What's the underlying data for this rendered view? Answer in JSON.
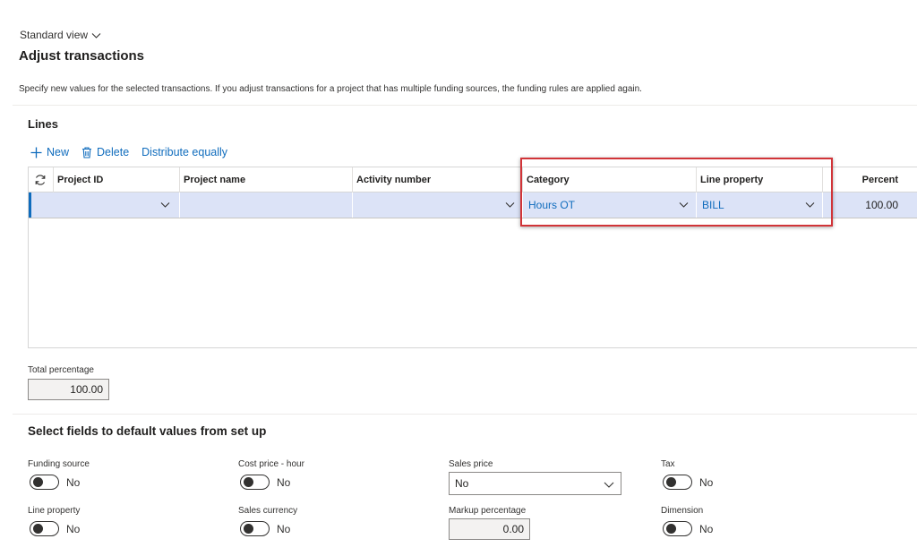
{
  "view": {
    "label": "Standard view"
  },
  "page": {
    "title": "Adjust transactions",
    "instructions": "Specify new values for the selected transactions. If you adjust transactions for a project that has multiple funding sources, the funding rules are applied again."
  },
  "lines": {
    "title": "Lines",
    "toolbar": {
      "new_label": "New",
      "delete_label": "Delete",
      "distribute_label": "Distribute equally"
    },
    "columns": {
      "project_id": "Project ID",
      "project_name": "Project name",
      "activity_number": "Activity number",
      "category": "Category",
      "line_property": "Line property",
      "percent": "Percent"
    },
    "rows": [
      {
        "project_id": "",
        "project_name": "",
        "activity_number": "",
        "category": "Hours OT",
        "line_property": "BILL",
        "percent": "100.00"
      }
    ]
  },
  "total": {
    "label": "Total percentage",
    "value": "100.00"
  },
  "defaults": {
    "title": "Select fields to default values from set up",
    "funding_source": {
      "label": "Funding source",
      "value": "No"
    },
    "cost_price_hour": {
      "label": "Cost price - hour",
      "value": "No"
    },
    "sales_price": {
      "label": "Sales price",
      "value": "No"
    },
    "tax": {
      "label": "Tax",
      "value": "No"
    },
    "line_property": {
      "label": "Line property",
      "value": "No"
    },
    "sales_currency": {
      "label": "Sales currency",
      "value": "No"
    },
    "markup_percentage": {
      "label": "Markup percentage",
      "value": "0.00"
    },
    "dimension": {
      "label": "Dimension",
      "value": "No"
    }
  },
  "colors": {
    "accent": "#0f6cbd",
    "highlight": "#d13438",
    "selected_row": "#dce3f7"
  }
}
